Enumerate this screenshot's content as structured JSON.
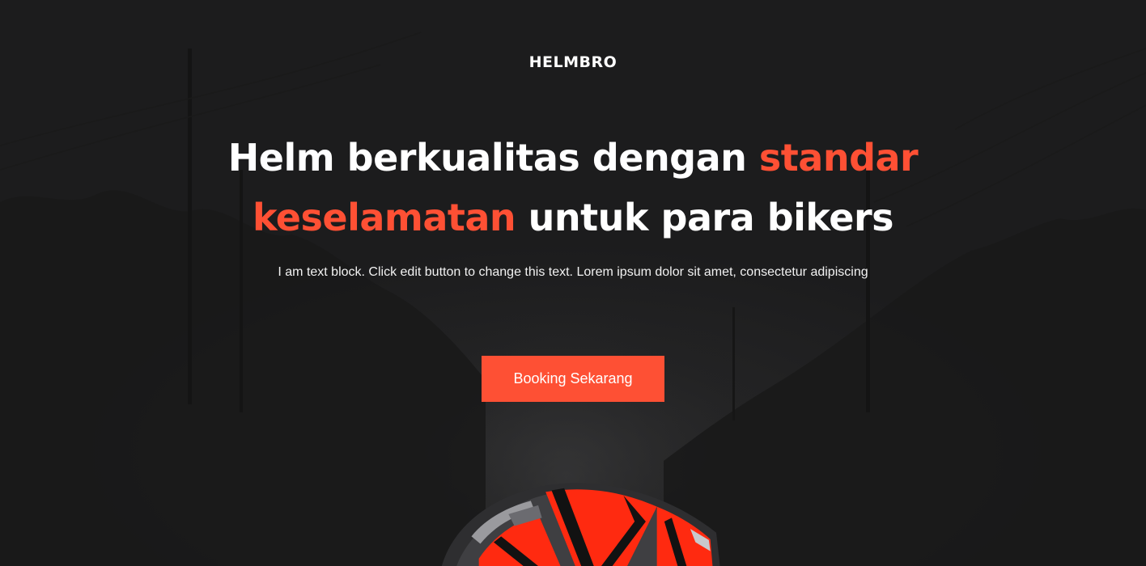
{
  "brand": {
    "name": "HELMBRO"
  },
  "hero": {
    "headline_part1": "Helm berkualitas dengan ",
    "headline_accent1": "standar",
    "headline_accent2": "keselamatan",
    "headline_part2": " untuk para bikers",
    "subtext": "I am text block. Click edit button to change this text. Lorem ipsum dolor sit amet, consectetur adipiscing",
    "cta_label": "Booking Sekarang"
  },
  "colors": {
    "accent": "#fe5034",
    "background": "#1c1c1d",
    "text": "#ffffff"
  },
  "icons": {
    "product_image": "motorcycle-helmet"
  }
}
